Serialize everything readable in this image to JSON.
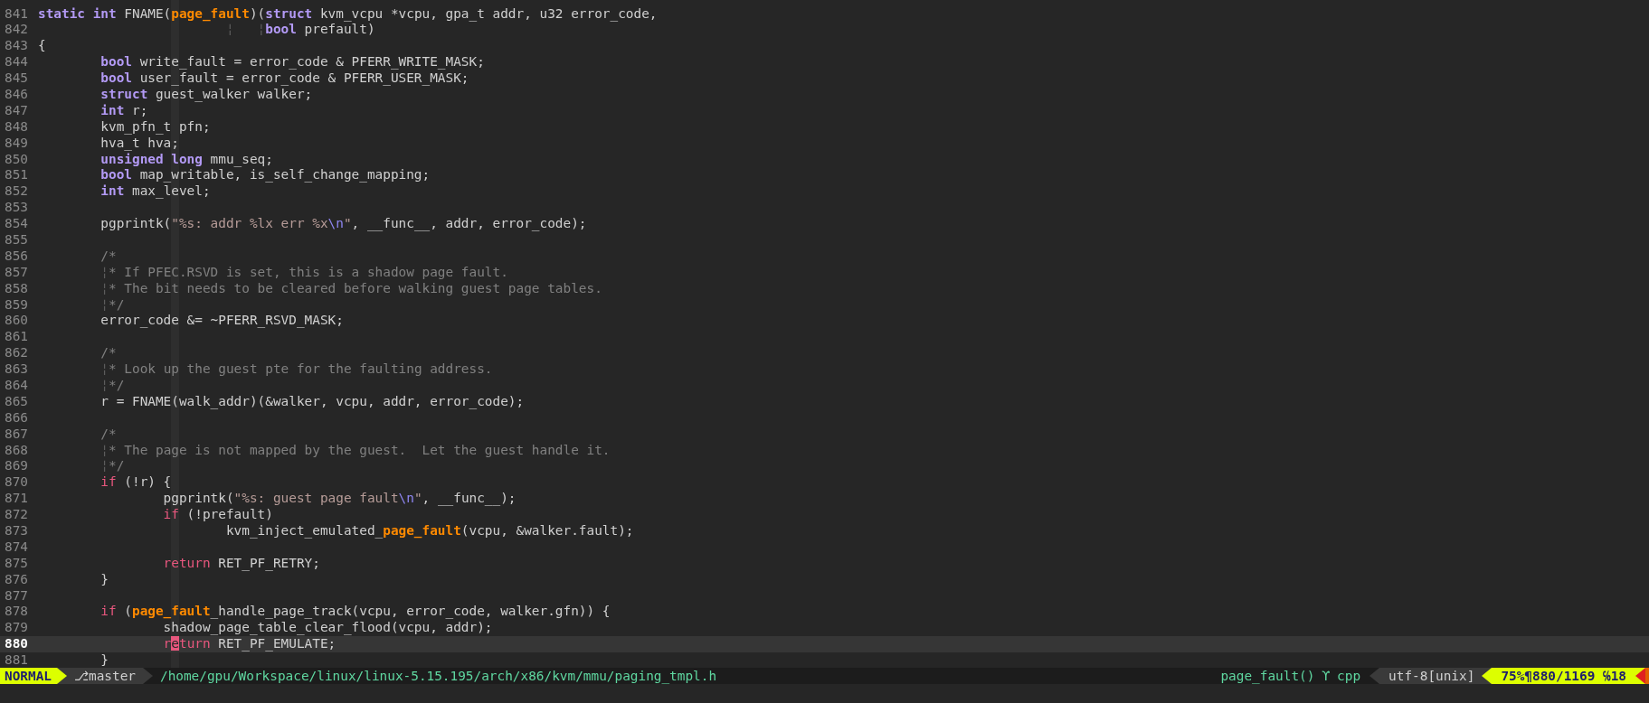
{
  "editor": {
    "lines": [
      {
        "number": "841",
        "current": false,
        "segments": [
          {
            "kind": "keyword",
            "text": "static"
          },
          {
            "kind": "keyword",
            "text": " int"
          },
          {
            "kind": "plain",
            "text": " FNAME("
          },
          {
            "kind": "function",
            "text": "page_fault"
          },
          {
            "kind": "plain",
            "text": ")("
          },
          {
            "kind": "keyword",
            "text": "struct"
          },
          {
            "kind": "plain",
            "text": " kvm_vcpu *vcpu, gpa_t addr, u32 error_code,"
          }
        ]
      },
      {
        "number": "842",
        "current": false,
        "segments": [
          {
            "kind": "guide",
            "text": "                        ¦"
          },
          {
            "kind": "guide",
            "text": "   ¦"
          },
          {
            "kind": "keyword",
            "text": "bool"
          },
          {
            "kind": "plain",
            "text": " prefault)"
          }
        ]
      },
      {
        "number": "843",
        "current": false,
        "segments": [
          {
            "kind": "plain",
            "text": "{"
          }
        ]
      },
      {
        "number": "844",
        "current": false,
        "segments": [
          {
            "kind": "keyword",
            "text": "        bool"
          },
          {
            "kind": "plain",
            "text": " write_fault = error_code & PFERR_WRITE_MASK;"
          }
        ]
      },
      {
        "number": "845",
        "current": false,
        "segments": [
          {
            "kind": "keyword",
            "text": "        bool"
          },
          {
            "kind": "plain",
            "text": " user_fault = error_code & PFERR_USER_MASK;"
          }
        ]
      },
      {
        "number": "846",
        "current": false,
        "segments": [
          {
            "kind": "keyword",
            "text": "        struct"
          },
          {
            "kind": "plain",
            "text": " guest_walker walker;"
          }
        ]
      },
      {
        "number": "847",
        "current": false,
        "segments": [
          {
            "kind": "keyword",
            "text": "        int"
          },
          {
            "kind": "plain",
            "text": " r;"
          }
        ]
      },
      {
        "number": "848",
        "current": false,
        "segments": [
          {
            "kind": "plain",
            "text": "        kvm_pfn_t pfn;"
          }
        ]
      },
      {
        "number": "849",
        "current": false,
        "segments": [
          {
            "kind": "plain",
            "text": "        hva_t hva;"
          }
        ]
      },
      {
        "number": "850",
        "current": false,
        "segments": [
          {
            "kind": "keyword",
            "text": "        unsigned"
          },
          {
            "kind": "keyword",
            "text": " long"
          },
          {
            "kind": "plain",
            "text": " mmu_seq;"
          }
        ]
      },
      {
        "number": "851",
        "current": false,
        "segments": [
          {
            "kind": "keyword",
            "text": "        bool"
          },
          {
            "kind": "plain",
            "text": " map_writable, is_self_change_mapping;"
          }
        ]
      },
      {
        "number": "852",
        "current": false,
        "segments": [
          {
            "kind": "keyword",
            "text": "        int"
          },
          {
            "kind": "plain",
            "text": " max_level;"
          }
        ]
      },
      {
        "number": "853",
        "current": false
      },
      {
        "number": "854",
        "current": false,
        "segments": [
          {
            "kind": "plain",
            "text": "        pgprintk("
          },
          {
            "kind": "string",
            "text": "\"%s: addr %lx err %x"
          },
          {
            "kind": "escape",
            "text": "\\n"
          },
          {
            "kind": "string",
            "text": "\""
          },
          {
            "kind": "plain",
            "text": ", __func__, addr, error_code);"
          }
        ]
      },
      {
        "number": "855",
        "current": false
      },
      {
        "number": "856",
        "current": false,
        "segments": [
          {
            "kind": "comment",
            "text": "        /*"
          }
        ]
      },
      {
        "number": "857",
        "current": false,
        "segments": [
          {
            "kind": "guide",
            "text": "        ¦"
          },
          {
            "kind": "comment",
            "text": "* If PFEC.RSVD is set, this is a shadow page fault."
          }
        ]
      },
      {
        "number": "858",
        "current": false,
        "segments": [
          {
            "kind": "guide",
            "text": "        ¦"
          },
          {
            "kind": "comment",
            "text": "* The bit needs to be cleared before walking guest page tables."
          }
        ]
      },
      {
        "number": "859",
        "current": false,
        "segments": [
          {
            "kind": "guide",
            "text": "        ¦"
          },
          {
            "kind": "comment",
            "text": "*/"
          }
        ]
      },
      {
        "number": "860",
        "current": false,
        "segments": [
          {
            "kind": "plain",
            "text": "        error_code &= ~PFERR_RSVD_MASK;"
          }
        ]
      },
      {
        "number": "861",
        "current": false
      },
      {
        "number": "862",
        "current": false,
        "segments": [
          {
            "kind": "comment",
            "text": "        /*"
          }
        ]
      },
      {
        "number": "863",
        "current": false,
        "segments": [
          {
            "kind": "guide",
            "text": "        ¦"
          },
          {
            "kind": "comment",
            "text": "* Look up the guest pte for the faulting address."
          }
        ]
      },
      {
        "number": "864",
        "current": false,
        "segments": [
          {
            "kind": "guide",
            "text": "        ¦"
          },
          {
            "kind": "comment",
            "text": "*/"
          }
        ]
      },
      {
        "number": "865",
        "current": false,
        "segments": [
          {
            "kind": "plain",
            "text": "        r = FNAME(walk_addr)(&walker, vcpu, addr, error_code);"
          }
        ]
      },
      {
        "number": "866",
        "current": false
      },
      {
        "number": "867",
        "current": false,
        "segments": [
          {
            "kind": "comment",
            "text": "        /*"
          }
        ]
      },
      {
        "number": "868",
        "current": false,
        "segments": [
          {
            "kind": "guide",
            "text": "        ¦"
          },
          {
            "kind": "comment",
            "text": "* The page is not mapped by the guest.  Let the guest handle it."
          }
        ]
      },
      {
        "number": "869",
        "current": false,
        "segments": [
          {
            "kind": "guide",
            "text": "        ¦"
          },
          {
            "kind": "comment",
            "text": "*/"
          }
        ]
      },
      {
        "number": "870",
        "current": false,
        "segments": [
          {
            "kind": "control",
            "text": "        if"
          },
          {
            "kind": "plain",
            "text": " (!r) {"
          }
        ]
      },
      {
        "number": "871",
        "current": false,
        "segments": [
          {
            "kind": "plain",
            "text": "                pgprintk("
          },
          {
            "kind": "string",
            "text": "\"%s: guest page fault"
          },
          {
            "kind": "escape",
            "text": "\\n"
          },
          {
            "kind": "string",
            "text": "\""
          },
          {
            "kind": "plain",
            "text": ", __func__);"
          }
        ]
      },
      {
        "number": "872",
        "current": false,
        "segments": [
          {
            "kind": "control",
            "text": "                if"
          },
          {
            "kind": "plain",
            "text": " (!prefault)"
          }
        ]
      },
      {
        "number": "873",
        "current": false,
        "segments": [
          {
            "kind": "plain",
            "text": "                        kvm_inject_emulated_"
          },
          {
            "kind": "function",
            "text": "page_fault"
          },
          {
            "kind": "plain",
            "text": "(vcpu, &walker.fault);"
          }
        ]
      },
      {
        "number": "874",
        "current": false
      },
      {
        "number": "875",
        "current": false,
        "segments": [
          {
            "kind": "control",
            "text": "                return"
          },
          {
            "kind": "plain",
            "text": " RET_PF_RETRY;"
          }
        ]
      },
      {
        "number": "876",
        "current": false,
        "segments": [
          {
            "kind": "plain",
            "text": "        }"
          }
        ]
      },
      {
        "number": "877",
        "current": false
      },
      {
        "number": "878",
        "current": false,
        "segments": [
          {
            "kind": "control",
            "text": "        if"
          },
          {
            "kind": "plain",
            "text": " ("
          },
          {
            "kind": "function",
            "text": "page_fault"
          },
          {
            "kind": "plain",
            "text": "_handle_page_track(vcpu, error_code, walker.gfn)) {"
          }
        ]
      },
      {
        "number": "879",
        "current": false,
        "segments": [
          {
            "kind": "plain",
            "text": "                shadow_page_table_clear_flood(vcpu, addr);"
          }
        ]
      },
      {
        "number": "880",
        "current": true,
        "segments": [
          {
            "kind": "control",
            "text": "                r"
          },
          {
            "kind": "cursor",
            "text": "e"
          },
          {
            "kind": "control",
            "text": "turn"
          },
          {
            "kind": "plain",
            "text": " RET_PF_EMULATE;"
          }
        ]
      },
      {
        "number": "881",
        "current": false,
        "segments": [
          {
            "kind": "plain",
            "text": "        }"
          }
        ]
      }
    ]
  },
  "status_bar": {
    "mode": "NORMAL",
    "branch": "⎇master",
    "file_path": "/home/gpu/Workspace/linux/linux-5.15.195/arch/x86/kvm/mmu/paging_tmpl.h",
    "function": "page_fault()",
    "filetype_symbol": "ϒ",
    "filetype": "cpp",
    "encoding": "utf-8[unix]",
    "position": "75%¶880/1169 ℅18"
  }
}
